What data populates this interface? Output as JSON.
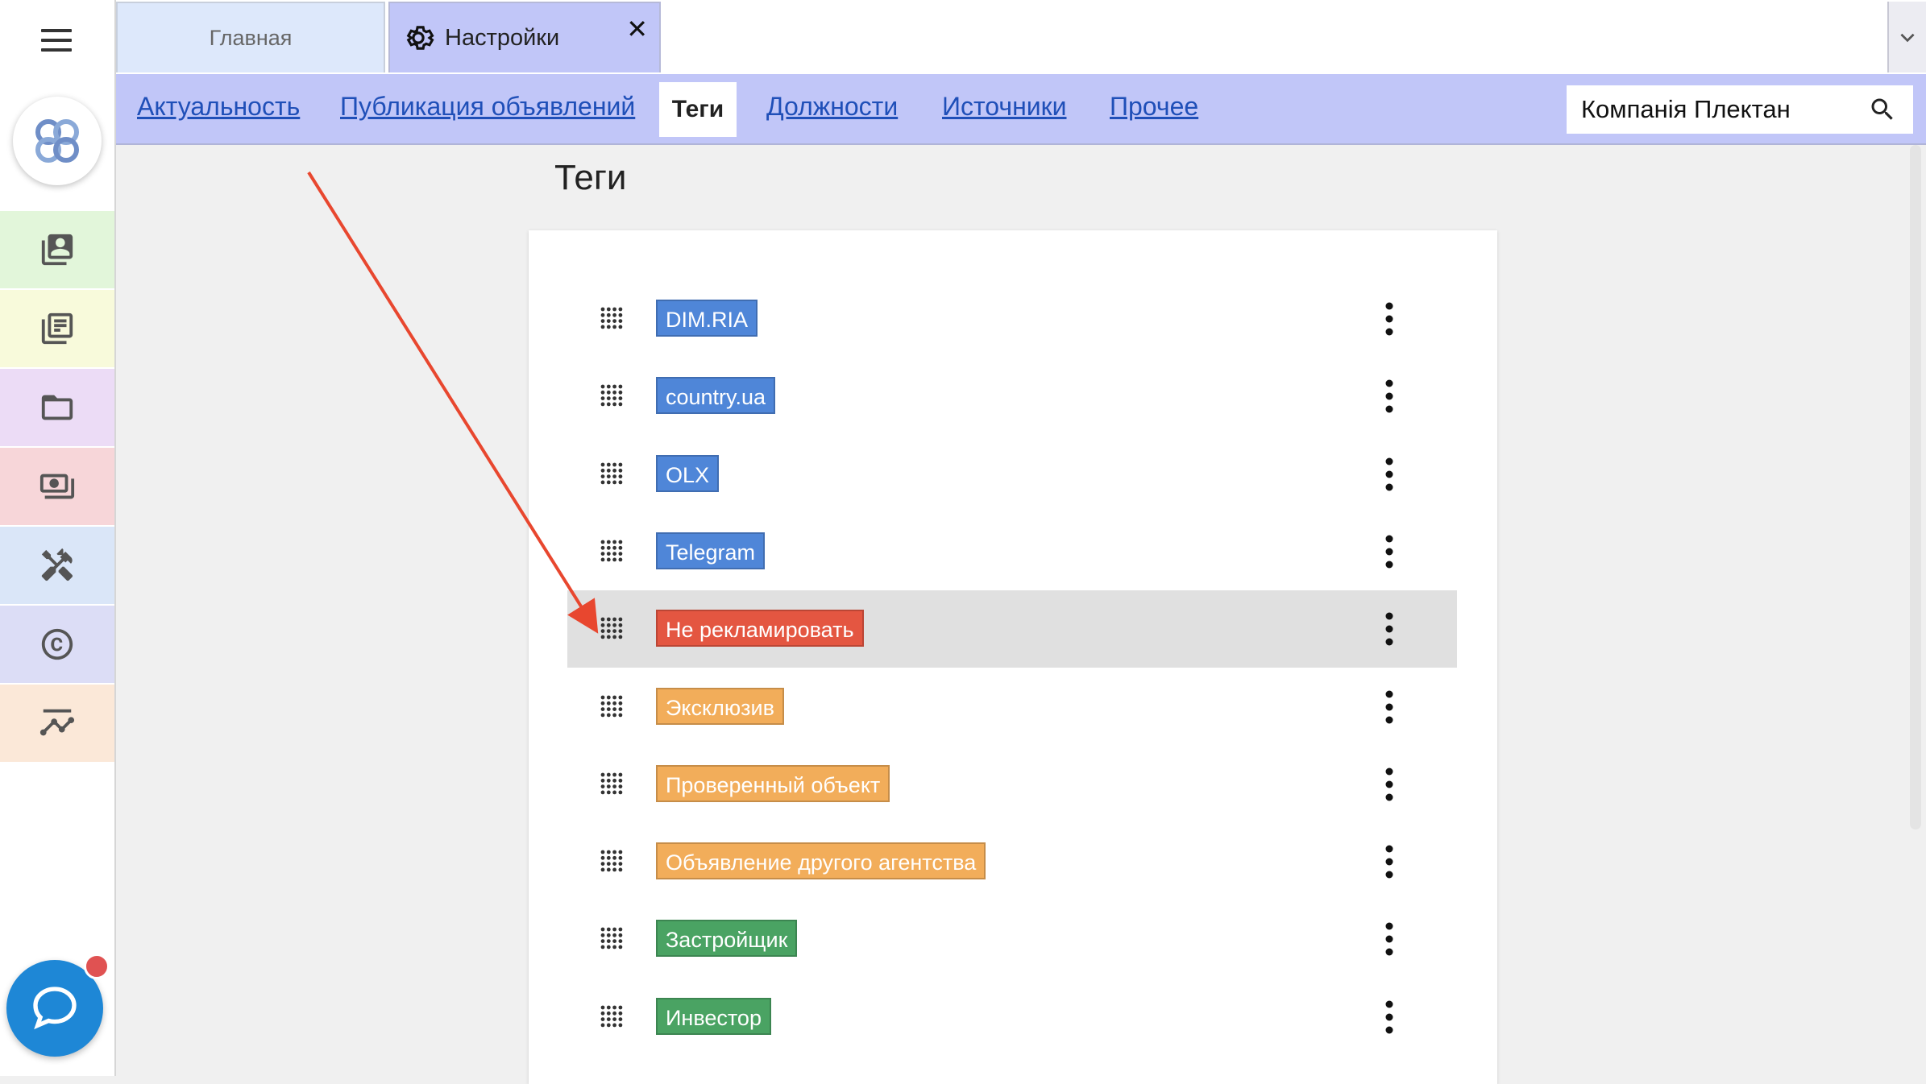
{
  "tabs": [
    {
      "label": "Главная"
    },
    {
      "label": "Настройки",
      "close": "✕"
    }
  ],
  "subnav": {
    "links": [
      "Актуальность",
      "Публикация объявлений",
      "Теги",
      "Должности",
      "Источники",
      "Прочее"
    ],
    "active": "Теги"
  },
  "company_search": {
    "value": "Компанія Плектан"
  },
  "page_title": "Теги",
  "tags": [
    {
      "label": "DIM.RIA",
      "color": "#4f86d8"
    },
    {
      "label": "country.ua",
      "color": "#4f86d8"
    },
    {
      "label": "OLX",
      "color": "#4f86d8"
    },
    {
      "label": "Telegram",
      "color": "#4f86d8"
    },
    {
      "label": "Не рекламировать",
      "color": "#e45641"
    },
    {
      "label": "Эксклюзив",
      "color": "#f2ad5a"
    },
    {
      "label": "Проверенный объект",
      "color": "#f2ad5a"
    },
    {
      "label": "Объявление другого агентства",
      "color": "#f2ad5a"
    },
    {
      "label": "Застройщик",
      "color": "#4aa363"
    },
    {
      "label": "Инвестор",
      "color": "#4aa363"
    }
  ],
  "highlighted_tag": "Не рекламировать",
  "sidebar": {
    "items": [
      {
        "icon": "contacts-icon",
        "color": "#e2f6da"
      },
      {
        "icon": "listings-icon",
        "color": "#f8fadb"
      },
      {
        "icon": "folder-icon",
        "color": "#ecdcf6"
      },
      {
        "icon": "money-icon",
        "color": "#f7d6d9"
      },
      {
        "icon": "tools-icon",
        "color": "#dae6f8"
      },
      {
        "icon": "copyright-icon",
        "color": "#dcddf6"
      },
      {
        "icon": "analytics-icon",
        "color": "#fbe8d8"
      }
    ]
  },
  "colors": {
    "tab_active": "#c1c6f8",
    "subnav_bg": "#c1c6f8",
    "link": "#1f4fb8",
    "chat_button": "#1e87d6",
    "arrow": "#e8472f"
  }
}
